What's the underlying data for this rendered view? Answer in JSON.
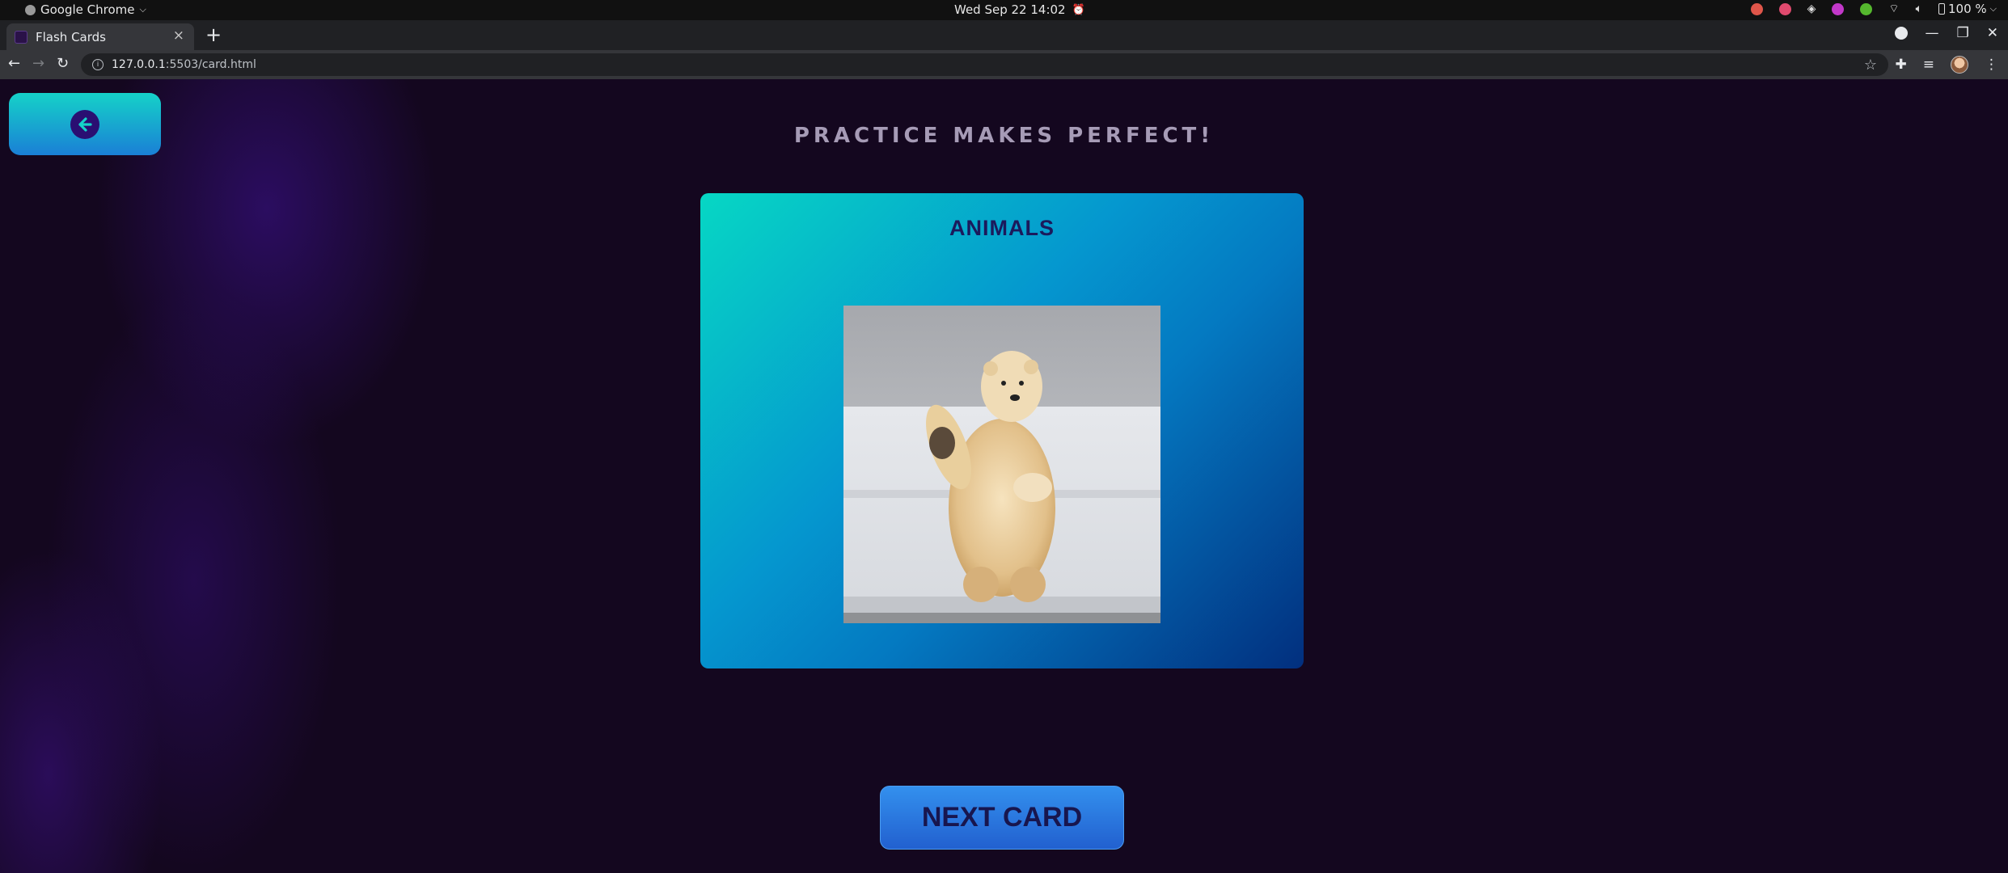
{
  "os": {
    "app_name": "Google Chrome",
    "app_caret": "⌵",
    "datetime": "Wed Sep 22  14:02",
    "alarm_glyph": "⏰",
    "battery": "100 %",
    "tray_colors": [
      "#e0564a",
      "#e04a6e",
      "#e0e0e0",
      "#c238c9",
      "#55b82e"
    ]
  },
  "browser": {
    "tab_title": "Flash Cards",
    "tab_close": "×",
    "new_tab": "+",
    "url_host": "127.0.0.1",
    "url_rest": ":5503/card.html",
    "back_glyph": "←",
    "forward_glyph": "→",
    "reload_glyph": "↻",
    "star_glyph": "☆",
    "extensions_glyph": "✚",
    "media_glyph": "≡",
    "menu_glyph": "⋮",
    "window_controls": {
      "minimize": "—",
      "maximize": "❐",
      "close": "✕"
    }
  },
  "page": {
    "title": "PRACTICE MAKES PERFECT!",
    "card": {
      "category": "ANIMALS",
      "image_label": "polar bear"
    },
    "next_button": "NEXT CARD"
  },
  "colors": {
    "background": "#14071f",
    "card_gradient_start": "#06d7c4",
    "card_gradient_end": "#022f7e",
    "next_button": "#2a74e0",
    "back_button_top": "#15d2c8",
    "title_text": "#a69bb6"
  }
}
